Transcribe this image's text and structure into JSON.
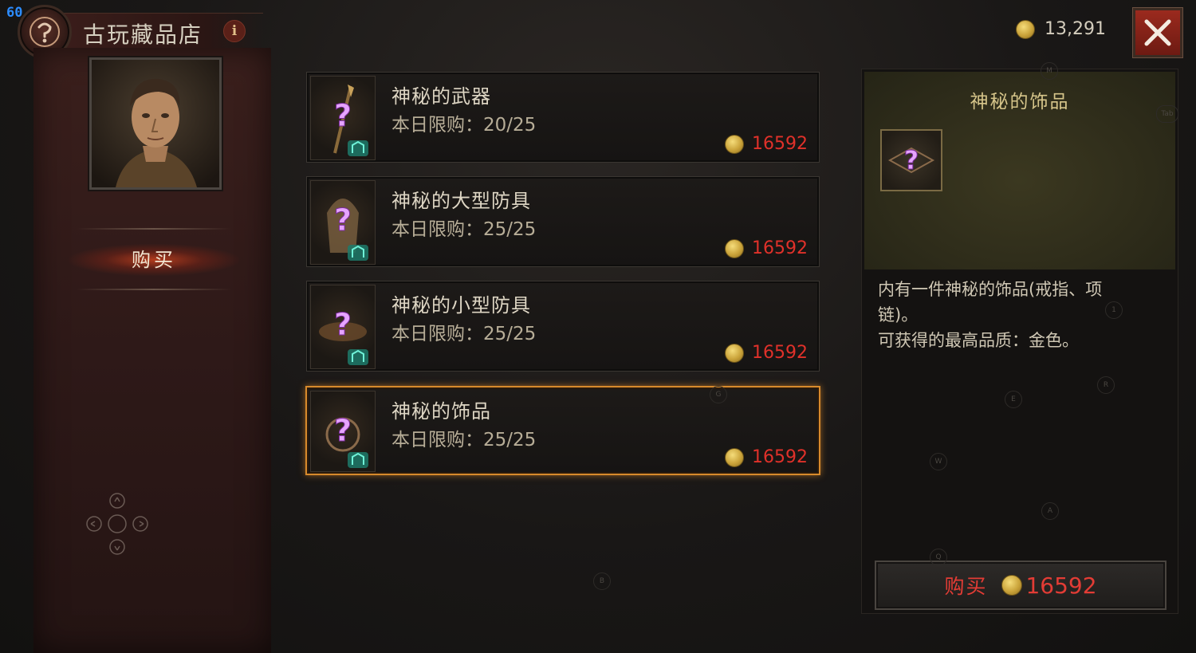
{
  "hud": {
    "fps": "60"
  },
  "header": {
    "title": "古玩藏品店",
    "info_glyph": "i"
  },
  "left_menu": {
    "tabs": [
      {
        "label": "购买",
        "active": true
      }
    ]
  },
  "wallet": {
    "gold": "13,291"
  },
  "items": [
    {
      "name": "神秘的武器",
      "limit_text": "本日限购：20/25",
      "price": "16592",
      "selected": false
    },
    {
      "name": "神秘的大型防具",
      "limit_text": "本日限购：25/25",
      "price": "16592",
      "selected": false
    },
    {
      "name": "神秘的小型防具",
      "limit_text": "本日限购：25/25",
      "price": "16592",
      "selected": false
    },
    {
      "name": "神秘的饰品",
      "limit_text": "本日限购：25/25",
      "price": "16592",
      "selected": true
    }
  ],
  "detail": {
    "title": "神秘的饰品",
    "desc_line1": "内有一件神秘的饰品(戒指、项",
    "desc_line2": "链)。",
    "desc_line3": "可获得的最高品质：金色。",
    "buy_label": "购买",
    "buy_price": "16592"
  },
  "key_hints": [
    "M",
    "Tab",
    "1",
    "E",
    "R",
    "G",
    "W",
    "A",
    "Q",
    "B"
  ],
  "colors": {
    "price_red": "#e0312a",
    "selected_border": "#d78a2c",
    "accent_gold": "#d6c58a",
    "fps_blue": "#2c8cff"
  },
  "icons": [
    "shop-emblem-icon",
    "info-icon",
    "close-icon",
    "coin-icon",
    "mystery-item-icon",
    "dpad-icon"
  ]
}
